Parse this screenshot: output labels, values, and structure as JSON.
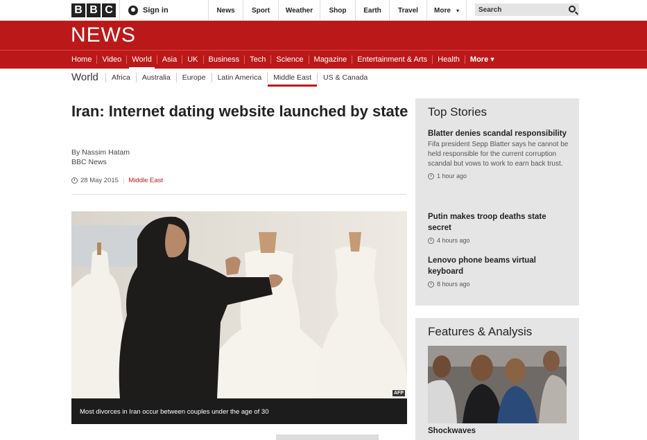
{
  "logo": {
    "letters": [
      "B",
      "B",
      "C"
    ]
  },
  "signin": {
    "label": "Sign in"
  },
  "topnav": {
    "items": [
      {
        "label": "News",
        "w": 50
      },
      {
        "label": "Sport",
        "w": 51
      },
      {
        "label": "Weather",
        "w": 60
      },
      {
        "label": "Shop",
        "w": 51
      },
      {
        "label": "Earth",
        "w": 49
      },
      {
        "label": "Travel",
        "w": 54
      },
      {
        "label": "More",
        "w": 58
      }
    ],
    "more_caret": "▾"
  },
  "search": {
    "placeholder": "Search"
  },
  "banner": {
    "title": "NEWS"
  },
  "rednav": {
    "items": [
      "Home",
      "Video",
      "World",
      "Asia",
      "UK",
      "Business",
      "Tech",
      "Science",
      "Magazine",
      "Entertainment & Arts",
      "Health",
      "More ▾"
    ],
    "active": "World"
  },
  "subnav": {
    "title": "World",
    "items": [
      "Africa",
      "Australia",
      "Europe",
      "Latin America",
      "Middle East",
      "US & Canada"
    ],
    "active": "Middle East"
  },
  "article": {
    "headline": "Iran: Internet dating website launched by state",
    "author": "By Nassim Hatam",
    "outlet": "BBC News",
    "date": "28 May 2015",
    "section": "Middle East",
    "photo_credit": "AFP",
    "caption": "Most divorces in Iran occur between couples under the age of 30"
  },
  "top_stories": {
    "title": "Top Stories",
    "stories": [
      {
        "title": "Blatter denies scandal responsibility",
        "summary": "Fifa president Sepp Blatter says he cannot be held responsible for the current corruption scandal but vows to work to earn back trust.",
        "time": "1 hour ago"
      },
      {
        "title": "Putin makes troop deaths state secret",
        "summary": "",
        "time": "4 hours ago"
      },
      {
        "title": "Lenovo phone beams virtual keyboard",
        "summary": "",
        "time": "8 hours ago"
      }
    ]
  },
  "features": {
    "title": "Features & Analysis",
    "first_title": "Shockwaves"
  }
}
